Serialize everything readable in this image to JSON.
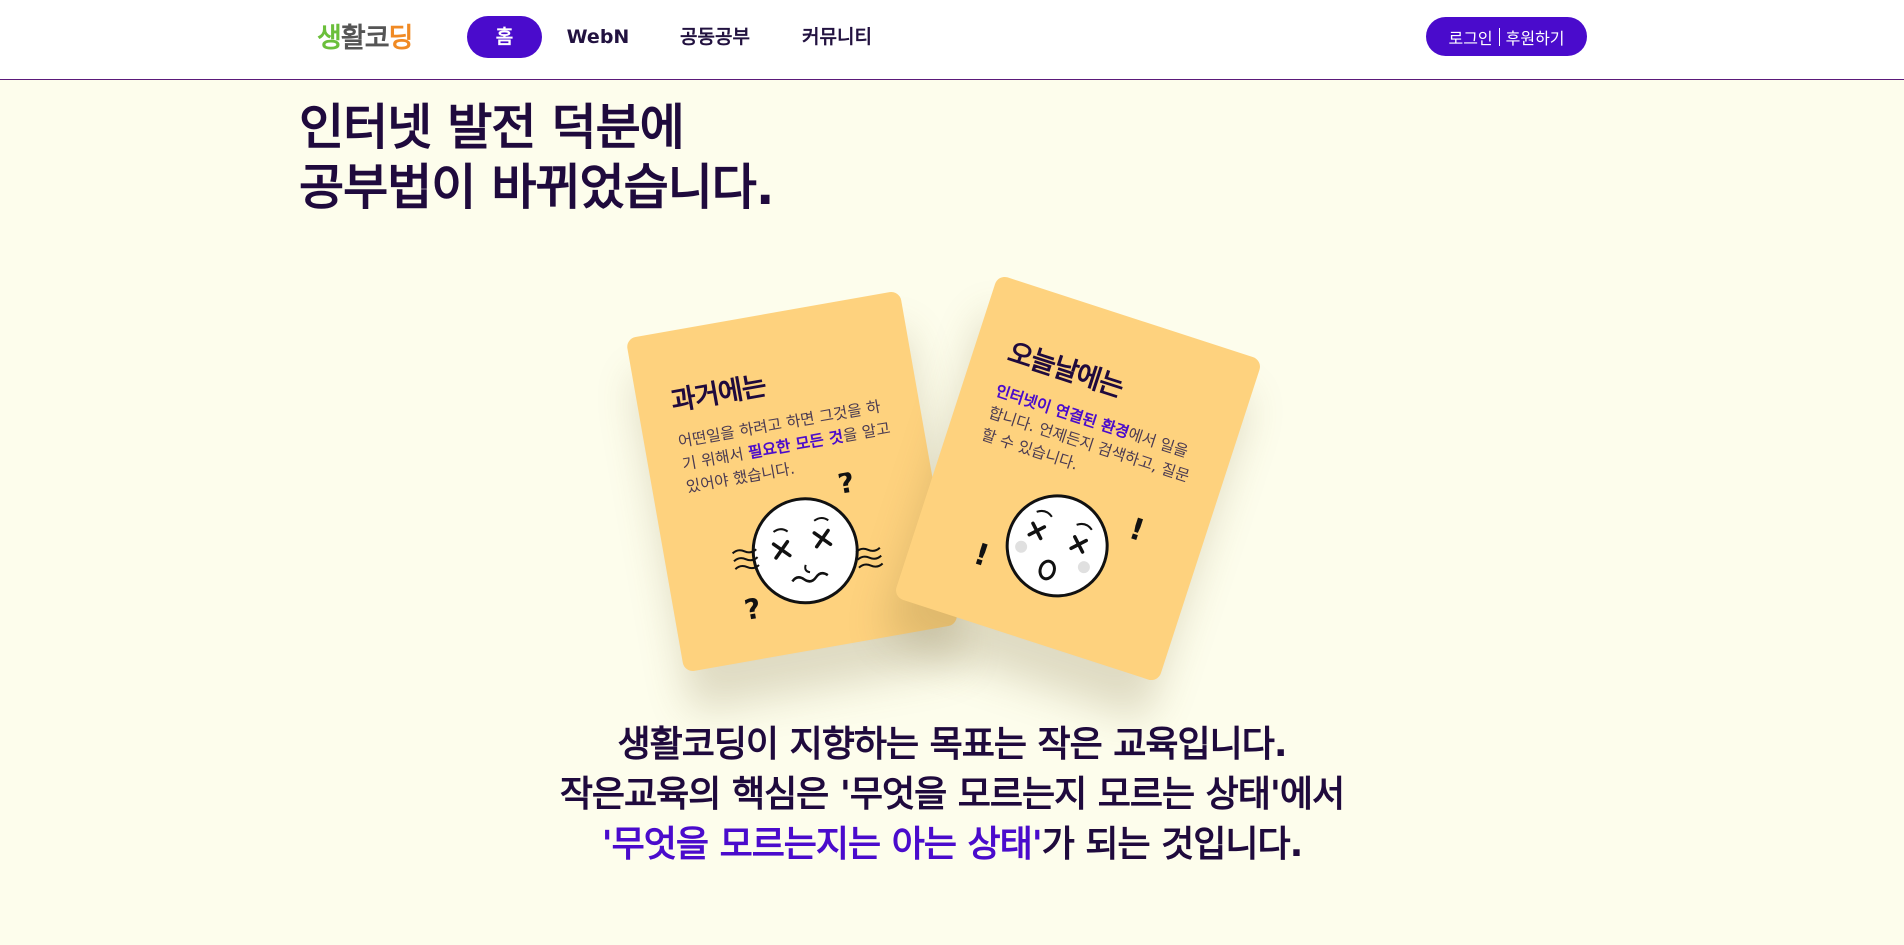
{
  "header": {
    "logo_chars": [
      {
        "char": "생",
        "color": "#6bbf3b"
      },
      {
        "char": "활",
        "color": "#555555"
      },
      {
        "char": "코",
        "color": "#555555"
      },
      {
        "char": "딩",
        "color": "#f08a24"
      }
    ],
    "nav": [
      {
        "label": "홈",
        "active": true
      },
      {
        "label": "WebN",
        "active": false
      },
      {
        "label": "공동공부",
        "active": false
      },
      {
        "label": "커뮤니티",
        "active": false
      }
    ],
    "login_label": "로그인",
    "sponsor_label": "후원하기"
  },
  "hero": {
    "line1": "인터넷 발전 덕분에",
    "line2": "공부법이 바뀌었습니다."
  },
  "cards": {
    "past": {
      "title": "과거에는",
      "text_before": "어떤일을 하려고 하면 그것을 하기 위해서 ",
      "highlight": "필요한 모든 것",
      "text_after": "을 알고 있어야 했습니다.",
      "face_icon": "dizzy-face-icon"
    },
    "today": {
      "title": "오늘날에는",
      "highlight": "인터넷이 연결된 환경",
      "text_after": "에서 일을 합니다. 언제든지 검색하고, 질문할 수 있습니다.",
      "face_icon": "surprised-face-icon"
    }
  },
  "bottom": {
    "line1": "생활코딩이 지향하는 목표는 작은 교육입니다.",
    "line2": "작은교육의 핵심은 '무엇을 모르는지 모르는 상태'에서",
    "line3_highlight": "'무엇을 모르는지는 아는 상태'",
    "line3_rest": "가 되는 것입니다."
  },
  "colors": {
    "accent": "#4a0bcc",
    "background": "#fdfdec",
    "card": "#fed27e",
    "text": "#1f0a3d"
  }
}
